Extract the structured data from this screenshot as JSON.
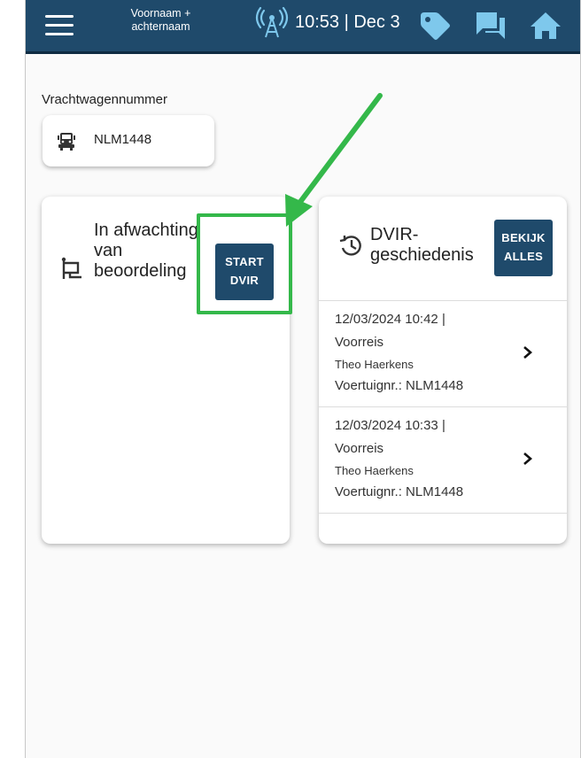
{
  "header": {
    "user_name": "Voornaam + achternaam",
    "time_date": "10:53 | Dec 3",
    "bar_color": "#1f4a6b",
    "icons": [
      "menu-icon",
      "signal-icon",
      "tag-icon",
      "chat-icon",
      "home-icon"
    ]
  },
  "vehicle": {
    "label": "Vrachtwagennummer",
    "number": "NLM1448",
    "icon": "truck-icon"
  },
  "status_card": {
    "status": "In afwachting van beoordeling",
    "start_button": "START DVIR",
    "icon": "flag-icon",
    "highlight_color": "#34b84a"
  },
  "history_card": {
    "title": "DVIR-geschiedenis",
    "view_all_button": "BEKIJK ALLES",
    "icon": "history-icon",
    "entries": [
      {
        "datetime": "12/03/2024 10:42 |",
        "type": "Voorreis",
        "driver": "Theo Haerkens",
        "vehicle": "Voertuignr.: NLM1448"
      },
      {
        "datetime": "12/03/2024 10:33 |",
        "type": "Voorreis",
        "driver": "Theo Haerkens",
        "vehicle": "Voertuignr.: NLM1448"
      }
    ]
  }
}
